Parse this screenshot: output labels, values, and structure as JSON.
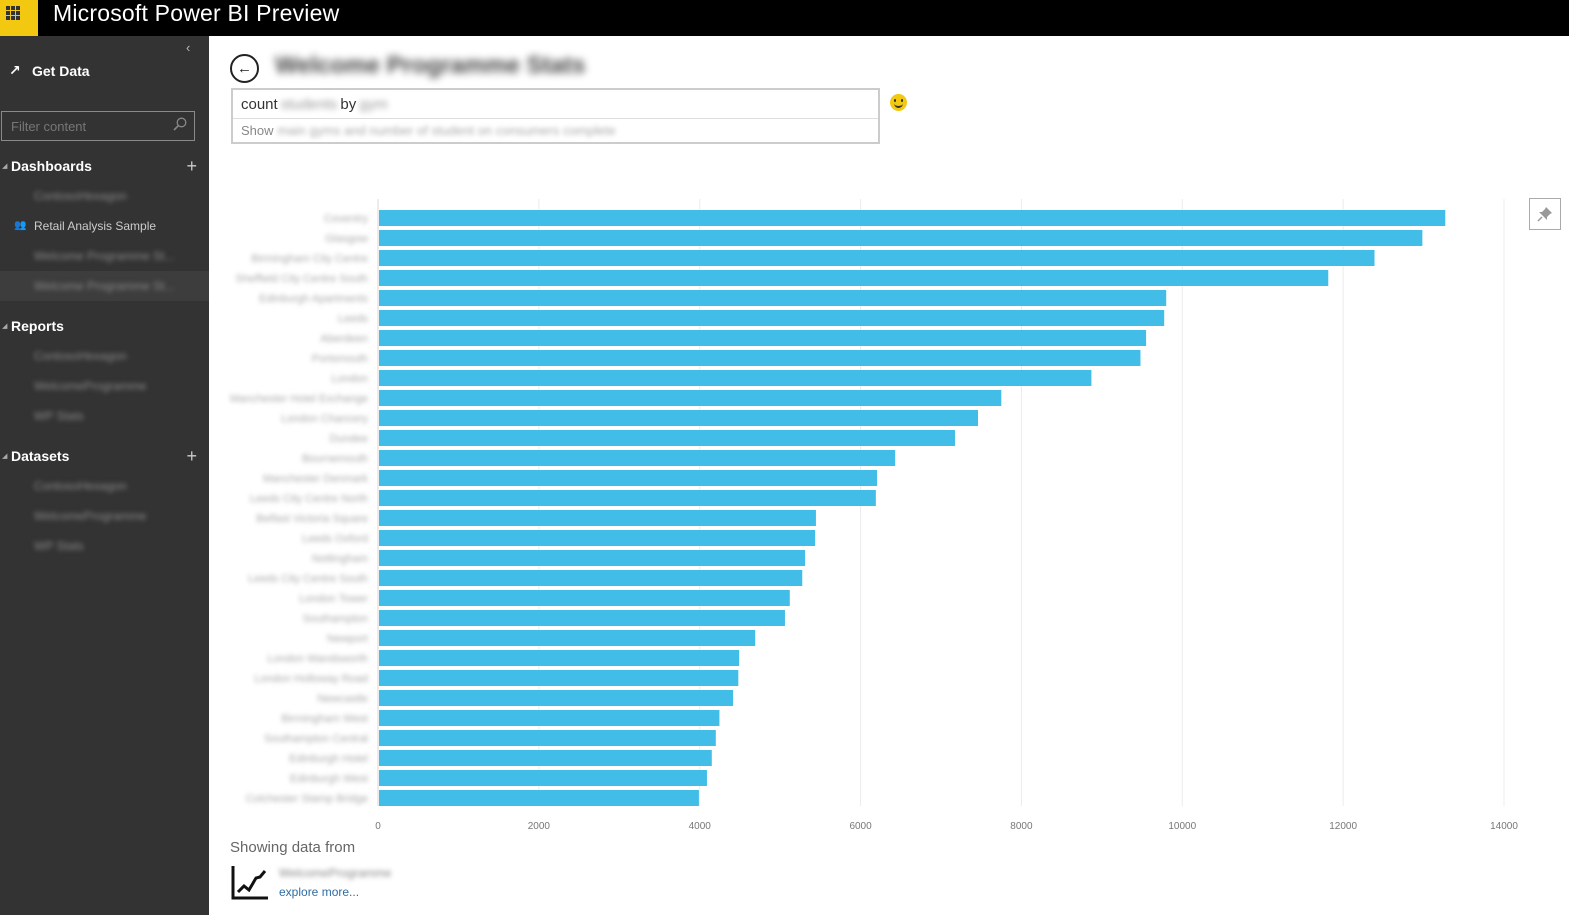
{
  "app": {
    "title": "Microsoft Power BI Preview",
    "waffle_icon": "app-launcher-icon"
  },
  "sidebar": {
    "collapse_icon": "‹",
    "get_data_label": "Get Data",
    "filter_placeholder": "Filter content",
    "sections": [
      {
        "name": "Dashboards",
        "items": [
          {
            "label": "ContosoHexagon",
            "redacted": true
          },
          {
            "label": "Retail Analysis Sample",
            "redacted": false,
            "shared": true
          },
          {
            "label": "Welcome Programme St...",
            "redacted": true
          },
          {
            "label": "Welcome Programme St...",
            "redacted": true,
            "selected": true
          }
        ]
      },
      {
        "name": "Reports",
        "items": [
          {
            "label": "ContosoHexagon",
            "redacted": true
          },
          {
            "label": "WelcomeProgramme",
            "redacted": true
          },
          {
            "label": "WP Stats",
            "redacted": true
          }
        ]
      },
      {
        "name": "Datasets",
        "items": [
          {
            "label": "ContosoHexagon",
            "redacted": true
          },
          {
            "label": "WelcomeProgramme",
            "redacted": true
          },
          {
            "label": "WP Stats",
            "redacted": true
          }
        ]
      }
    ]
  },
  "main": {
    "dashboard_title": "Welcome Programme Stats",
    "qa": {
      "query_prefix": "count",
      "query_mid_redacted": "students",
      "query_by": "by",
      "query_end_redacted": "gym",
      "suggestion_prefix": "Show",
      "suggestion_redacted": "main gyms and number of student on consumers complete"
    },
    "footer": {
      "showing_label": "Showing data from",
      "source_name_redacted": "WelcomeProgramme",
      "explore_label": "explore more..."
    }
  },
  "chart_data": {
    "type": "bar",
    "orientation": "horizontal",
    "title": "",
    "xlabel": "",
    "ylabel": "",
    "xlim": [
      0,
      14000
    ],
    "xticks": [
      0,
      2000,
      4000,
      6000,
      8000,
      10000,
      12000,
      14000
    ],
    "grid": true,
    "bar_color": "#42bde8",
    "categories": [
      "Coventry",
      "Glasgow",
      "Birmingham City Centre",
      "Sheffield City Centre South",
      "Edinburgh Apartments",
      "Leeds",
      "Aberdeen",
      "Portsmouth",
      "London",
      "Manchester Hotel Exchange",
      "London Chancery",
      "Dundee",
      "Bournemouth",
      "Manchester Denmark",
      "Leeds City Centre North",
      "Belfast Victoria Square",
      "Leeds Oxford",
      "Nottingham",
      "Leeds City Centre South",
      "London Tower",
      "Southampton",
      "Newport",
      "London Wandsworth",
      "London Holloway Road",
      "Newcastle",
      "Birmingham West",
      "Southampton Central",
      "Edinburgh Hotel",
      "Edinburgh West",
      "Colchester Stamp Bridge"
    ],
    "categories_redacted": true,
    "values": [
      13270,
      12985,
      12390,
      11815,
      9800,
      9775,
      9550,
      9480,
      8870,
      7750,
      7460,
      7175,
      6430,
      6205,
      6190,
      5445,
      5435,
      5310,
      5275,
      5120,
      5060,
      4690,
      4490,
      4480,
      4415,
      4245,
      4200,
      4150,
      4090,
      3990
    ]
  }
}
